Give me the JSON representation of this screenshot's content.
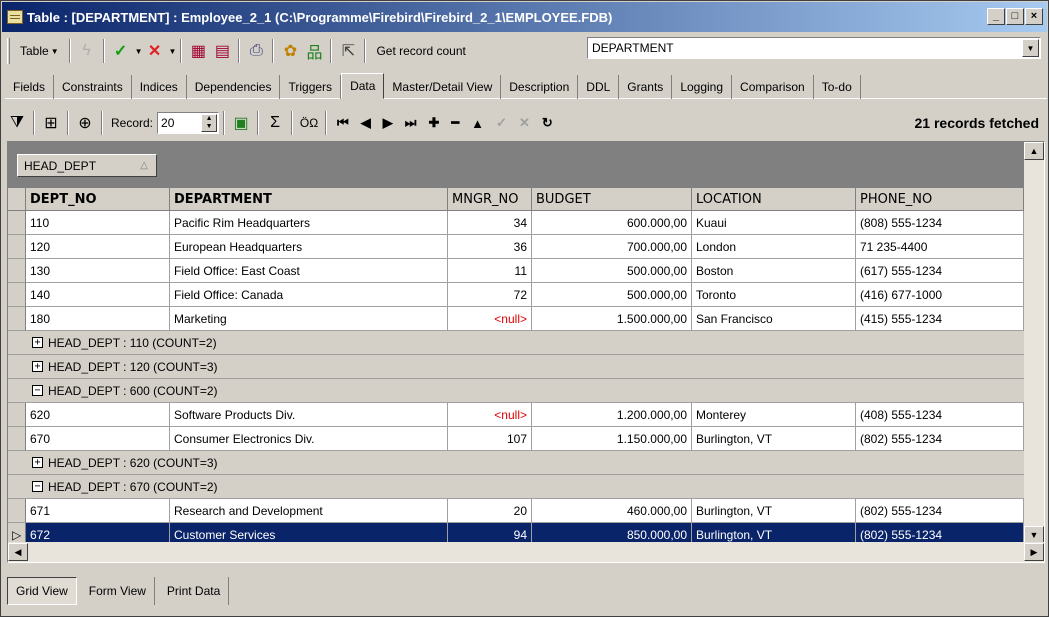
{
  "window": {
    "title": "Table : [DEPARTMENT] : Employee_2_1 (C:\\Programme\\Firebird\\Firebird_2_1\\EMPLOYEE.FDB)",
    "controls": [
      "minimize",
      "maximize",
      "close"
    ]
  },
  "toolbar": {
    "table_label": "Table",
    "get_record_count": "Get record count",
    "table_combo_value": "DEPARTMENT"
  },
  "tabs": [
    "Fields",
    "Constraints",
    "Indices",
    "Dependencies",
    "Triggers",
    "Data",
    "Master/Detail View",
    "Description",
    "DDL",
    "Grants",
    "Logging",
    "Comparison",
    "To-do"
  ],
  "active_tab": "Data",
  "data_toolbar": {
    "record_label": "Record:",
    "record_value": "20",
    "records_fetched": "21 records fetched"
  },
  "grid": {
    "group_chip": "HEAD_DEPT",
    "columns": [
      "DEPT_NO",
      "DEPARTMENT",
      "MNGR_NO",
      "BUDGET",
      "LOCATION",
      "PHONE_NO"
    ],
    "rows": [
      {
        "kind": "data",
        "cells": [
          "110",
          "Pacific Rim Headquarters",
          "34",
          "600.000,00",
          "Kuaui",
          "(808) 555-1234"
        ]
      },
      {
        "kind": "data",
        "cells": [
          "120",
          "European Headquarters",
          "36",
          "700.000,00",
          "London",
          "71 235-4400"
        ]
      },
      {
        "kind": "data",
        "cells": [
          "130",
          "Field Office: East Coast",
          "11",
          "500.000,00",
          "Boston",
          "(617) 555-1234"
        ]
      },
      {
        "kind": "data",
        "cells": [
          "140",
          "Field Office: Canada",
          "72",
          "500.000,00",
          "Toronto",
          "(416) 677-1000"
        ]
      },
      {
        "kind": "data",
        "cells": [
          "180",
          "Marketing",
          "<null>",
          "1.500.000,00",
          "San Francisco",
          "(415) 555-1234"
        ]
      },
      {
        "kind": "group",
        "expanded": false,
        "label": "HEAD_DEPT : 110 (COUNT=2)"
      },
      {
        "kind": "group",
        "expanded": false,
        "label": "HEAD_DEPT : 120 (COUNT=3)"
      },
      {
        "kind": "group",
        "expanded": true,
        "label": "HEAD_DEPT : 600 (COUNT=2)"
      },
      {
        "kind": "data",
        "cells": [
          "620",
          "Software Products Div.",
          "<null>",
          "1.200.000,00",
          "Monterey",
          "(408) 555-1234"
        ]
      },
      {
        "kind": "data",
        "cells": [
          "670",
          "Consumer Electronics Div.",
          "107",
          "1.150.000,00",
          "Burlington, VT",
          "(802) 555-1234"
        ]
      },
      {
        "kind": "group",
        "expanded": false,
        "label": "HEAD_DEPT : 620 (COUNT=3)"
      },
      {
        "kind": "group",
        "expanded": true,
        "label": "HEAD_DEPT : 670 (COUNT=2)"
      },
      {
        "kind": "data",
        "cells": [
          "671",
          "Research and Development",
          "20",
          "460.000,00",
          "Burlington, VT",
          "(802) 555-1234"
        ]
      },
      {
        "kind": "data",
        "selected": true,
        "cells": [
          "672",
          "Customer Services",
          "94",
          "850.000,00",
          "Burlington, VT",
          "(802) 555-1234"
        ]
      }
    ]
  },
  "bottom_tabs": [
    "Grid View",
    "Form View",
    "Print Data"
  ],
  "active_bottom_tab": "Grid View",
  "colors": {
    "selection": "#0a246a",
    "null_text": "#e00000",
    "title_gradient_start": "#0a246a"
  }
}
